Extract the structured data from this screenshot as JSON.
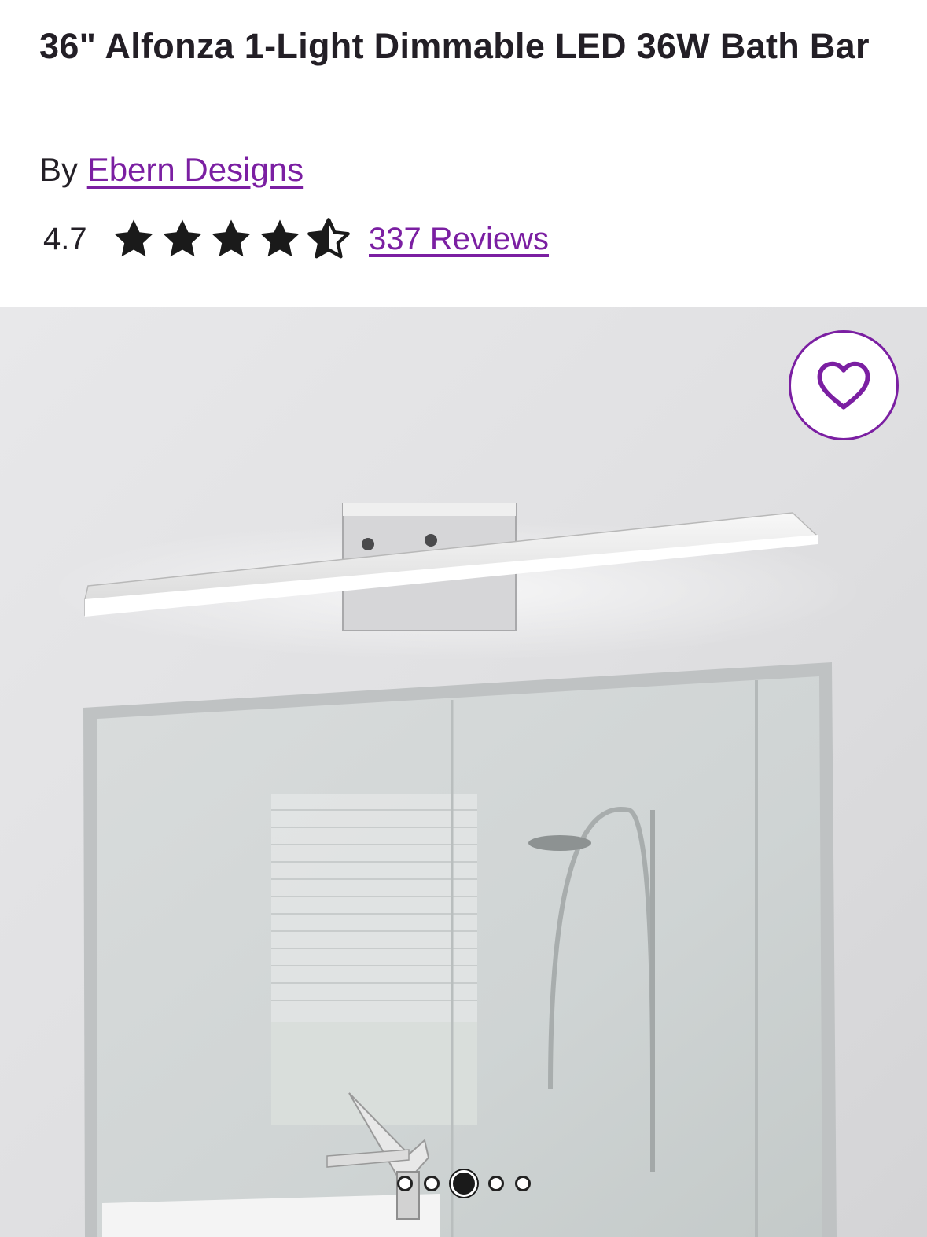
{
  "product": {
    "title": "36\" Alfonza 1-Light Dimmable LED 36W Bath Bar",
    "by_label": "By",
    "brand": "Ebern Designs",
    "rating": "4.7",
    "rating_value": 4.7,
    "rating_max": 5,
    "reviews_label": "337 Reviews"
  },
  "gallery": {
    "image_count": 5,
    "active_index": 3,
    "favorite_icon": "heart-icon"
  },
  "colors": {
    "accent": "#7b1fa2",
    "text": "#231f26"
  }
}
